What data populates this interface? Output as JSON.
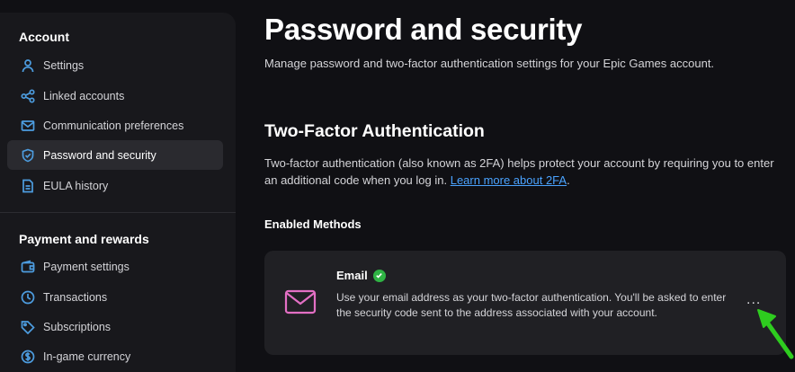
{
  "sidebar": {
    "account_title": "Account",
    "account_items": [
      {
        "label": "Settings",
        "icon": "user-icon"
      },
      {
        "label": "Linked accounts",
        "icon": "share-icon"
      },
      {
        "label": "Communication preferences",
        "icon": "mail-icon"
      },
      {
        "label": "Password and security",
        "icon": "shield-icon",
        "active": true
      },
      {
        "label": "EULA history",
        "icon": "document-icon"
      }
    ],
    "payment_title": "Payment and rewards",
    "payment_items": [
      {
        "label": "Payment settings",
        "icon": "wallet-icon"
      },
      {
        "label": "Transactions",
        "icon": "clock-icon"
      },
      {
        "label": "Subscriptions",
        "icon": "tag-icon"
      },
      {
        "label": "In-game currency",
        "icon": "coin-icon"
      }
    ]
  },
  "main": {
    "title": "Password and security",
    "subtitle": "Manage password and two-factor authentication settings for your Epic Games account.",
    "tfa_heading": "Two-Factor Authentication",
    "tfa_desc": "Two-factor authentication (also known as 2FA) helps protect your account by requiring you to enter an additional code when you log in.",
    "tfa_link": "Learn more about 2FA",
    "enabled_methods": "Enabled Methods",
    "email_card": {
      "title": "Email",
      "text": "Use your email address as your two-factor authentication. You'll be asked to enter the security code sent to the address associated with your account.",
      "more_label": "..."
    }
  },
  "colors": {
    "accent_blue": "#4d9de0",
    "link": "#4aa3ff",
    "mail_icon": "#e36fc4",
    "success": "#2fb344",
    "annotation_arrow": "#2ecc1f"
  }
}
